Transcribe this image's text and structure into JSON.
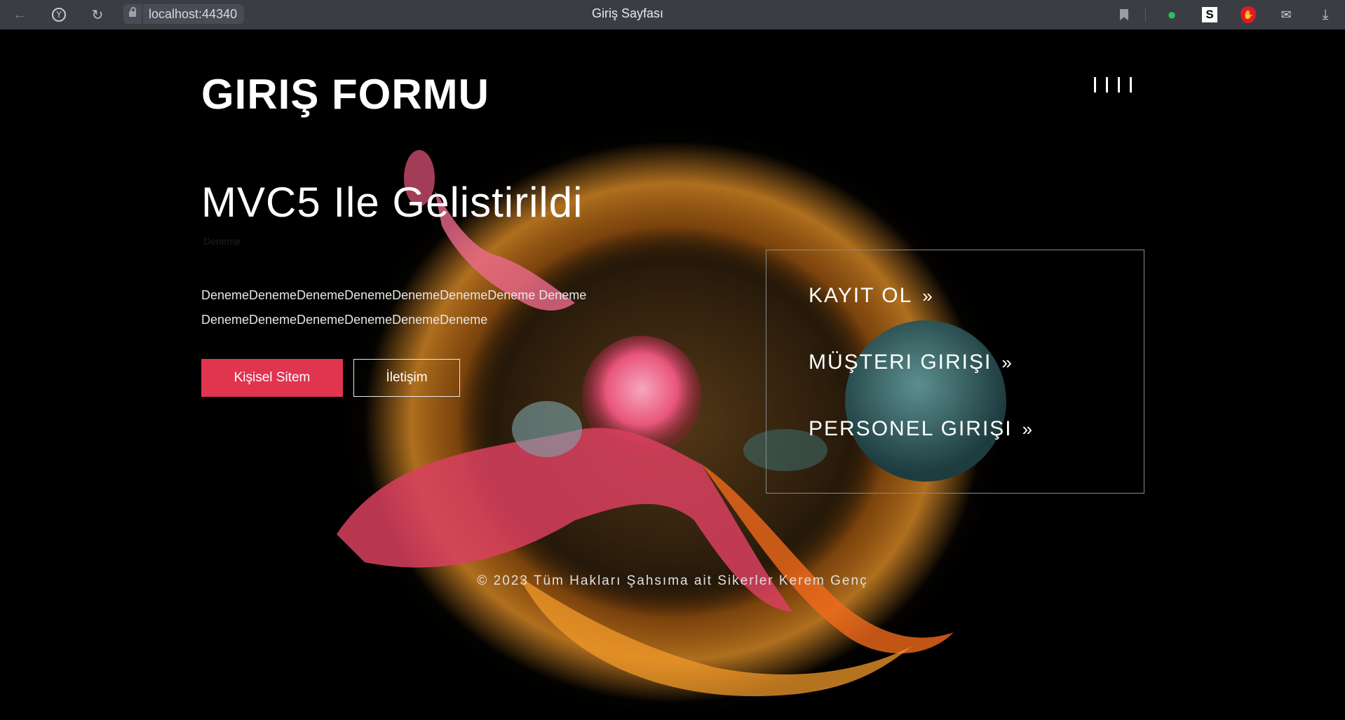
{
  "browser": {
    "url": "localhost:44340",
    "tab_title": "Giriş Sayfası",
    "icons": [
      "back-icon",
      "yandex-icon",
      "reload-icon",
      "lock-icon",
      "bookmark-icon",
      "evernote-icon",
      "s-extension-icon",
      "ublock-icon",
      "translate-icon",
      "download-icon"
    ]
  },
  "header": {
    "title": "GIRIŞ FORMU",
    "menu_icon": "hamburger-icon"
  },
  "hero": {
    "headline": "MVC5 Ile Gelistirildi",
    "subtle_text": "Deneme",
    "body": "DenemeDenemeDenemeDenemeDenemeDenemeDeneme DenemeDenemeDenemeDenemeDenemeDenemeDeneme",
    "primary_button": "Kişisel Sitem",
    "secondary_button": "İletişim"
  },
  "panel": {
    "links": [
      {
        "label": "KAYIT OL",
        "arrow": "»"
      },
      {
        "label": "MÜŞTERI GIRIŞI",
        "arrow": "»"
      },
      {
        "label": "PERSONEL GIRIŞI",
        "arrow": "»"
      }
    ]
  },
  "footer": {
    "text": "© 2023 Tüm Hakları Şahsıma ait Sikerler Kerem Genç"
  },
  "colors": {
    "accent": "#e0344f",
    "chrome": "#3b3d45",
    "background": "#000000",
    "art_orange": "#f39a2a",
    "art_pink": "#e8557a",
    "art_teal": "#3e6f6f"
  }
}
